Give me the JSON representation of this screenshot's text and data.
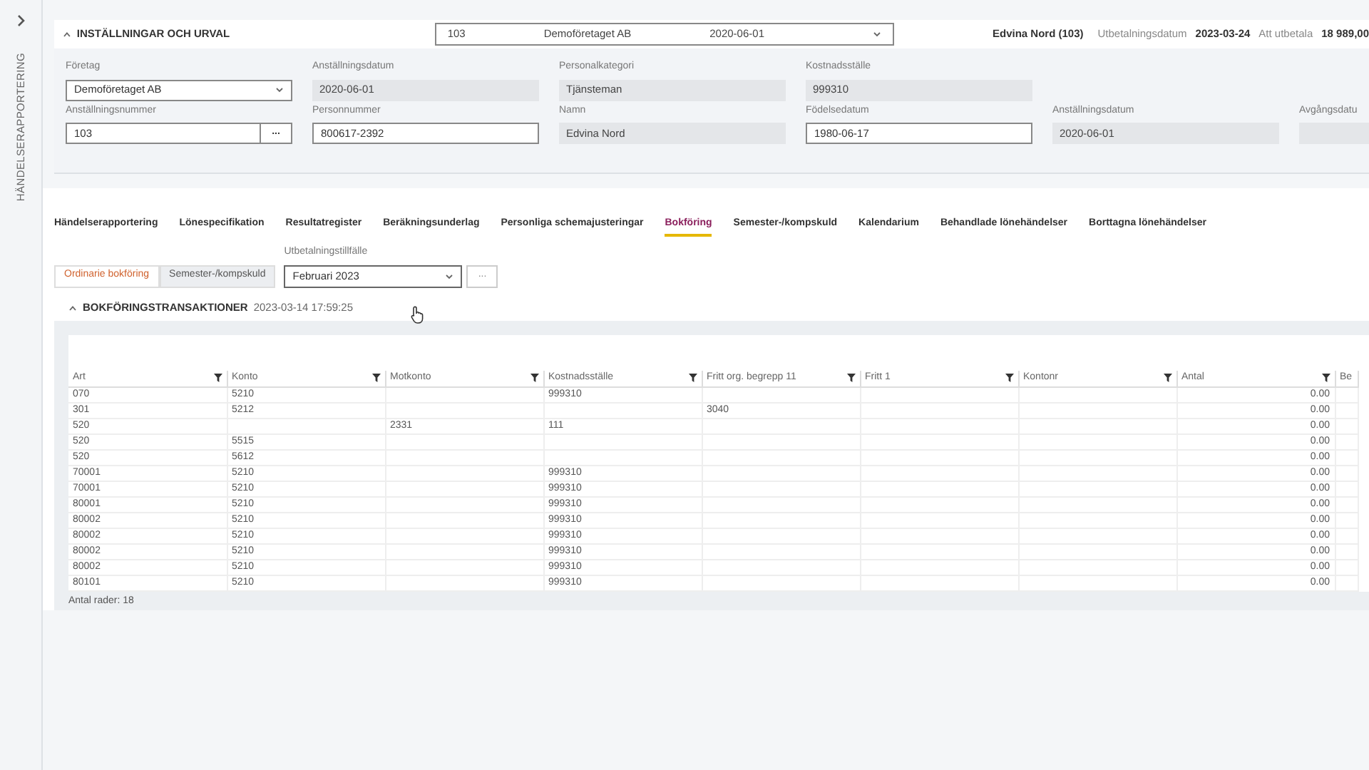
{
  "sidebar": {
    "title": "HÄNDELSERAPPORTERING"
  },
  "header": {
    "title": "INSTÄLLNINGAR OCH URVAL",
    "employee_select": [
      "103",
      "Demoföretaget AB",
      "2020-06-01"
    ],
    "employee": "Edvina Nord (103)",
    "payday_label": "Utbetalningsdatum",
    "payday": "2023-03-24",
    "pay_label": "Att utbetala",
    "pay": "18 989,00"
  },
  "fields": [
    {
      "label": "Företag",
      "value": "Demoföretaget AB",
      "kind": "select"
    },
    {
      "label": "Anställningsdatum",
      "value": "2020-06-01",
      "kind": "readonly"
    },
    {
      "label": "Personalkategori",
      "value": "Tjänsteman",
      "kind": "readonly"
    },
    {
      "label": "Kostnadsställe",
      "value": "999310",
      "kind": "readonly"
    },
    {
      "label": "Anställningsnummer",
      "value": "103",
      "kind": "lookup",
      "button": "..."
    },
    {
      "label": "Personnummer",
      "value": "800617-2392",
      "kind": "input"
    },
    {
      "label": "Namn",
      "value": "Edvina Nord",
      "kind": "readonly"
    },
    {
      "label": "Födelsedatum",
      "value": "1980-06-17",
      "kind": "input"
    },
    {
      "label": "Anställningsdatum",
      "value": "2020-06-01",
      "kind": "readonly"
    },
    {
      "label": "Avgångsdatu",
      "kind": "readonly"
    }
  ],
  "tabs": [
    {
      "label": "Händelserapportering",
      "selected": false
    },
    {
      "label": "Lönespecifikation",
      "selected": false
    },
    {
      "label": "Resultatregister",
      "selected": false
    },
    {
      "label": "Beräkningsunderlag",
      "selected": false
    },
    {
      "label": "Personliga schemajusteringar",
      "selected": false
    },
    {
      "label": "Bokföring",
      "selected": true
    },
    {
      "label": "Semester-/kompskuld",
      "selected": false
    },
    {
      "label": "Kalendarium",
      "selected": false
    },
    {
      "label": "Behandlade lönehändelser",
      "selected": false
    },
    {
      "label": "Borttagna lönehändelser",
      "selected": false
    }
  ],
  "subtabs": [
    {
      "label": "Ordinarie bokföring",
      "selected": true
    },
    {
      "label": "Semester-/kompskuld",
      "selected": false
    }
  ],
  "payout": {
    "label": "Utbetalningstillfälle",
    "value": "Februari 2023",
    "button": "..."
  },
  "section": {
    "title": "BOKFÖRINGSTRANSAKTIONER",
    "timestamp": "2023-03-14 17:59:25"
  },
  "table": {
    "columns": [
      {
        "label": "Art",
        "filter": true,
        "kind": "text"
      },
      {
        "label": "Konto",
        "filter": true,
        "kind": "text"
      },
      {
        "label": "Motkonto",
        "filter": true,
        "kind": "text"
      },
      {
        "label": "Kostnadsställe",
        "filter": true,
        "kind": "text"
      },
      {
        "label": "Fritt org. begrepp 11",
        "filter": true,
        "kind": "text"
      },
      {
        "label": "Fritt 1",
        "filter": true,
        "kind": "text"
      },
      {
        "label": "Kontonr",
        "filter": true,
        "kind": "text"
      },
      {
        "label": "Antal",
        "filter": true,
        "kind": "number"
      },
      {
        "label": "Be",
        "filter": false,
        "kind": "text"
      }
    ],
    "rows": [
      [
        "070",
        "5210",
        null,
        "999310",
        null,
        null,
        null,
        "0.00",
        null
      ],
      [
        "301",
        "5212",
        null,
        null,
        "3040",
        null,
        null,
        "0.00",
        null
      ],
      [
        "520",
        null,
        "2331",
        "111",
        null,
        null,
        null,
        "0.00",
        null
      ],
      [
        "520",
        "5515",
        null,
        null,
        null,
        null,
        null,
        "0.00",
        null
      ],
      [
        "520",
        "5612",
        null,
        null,
        null,
        null,
        null,
        "0.00",
        null
      ],
      [
        "70001",
        "5210",
        null,
        "999310",
        null,
        null,
        null,
        "0.00",
        null
      ],
      [
        "70001",
        "5210",
        null,
        "999310",
        null,
        null,
        null,
        "0.00",
        null
      ],
      [
        "80001",
        "5210",
        null,
        "999310",
        null,
        null,
        null,
        "0.00",
        null
      ],
      [
        "80002",
        "5210",
        null,
        "999310",
        null,
        null,
        null,
        "0.00",
        null
      ],
      [
        "80002",
        "5210",
        null,
        "999310",
        null,
        null,
        null,
        "0.00",
        null
      ],
      [
        "80002",
        "5210",
        null,
        "999310",
        null,
        null,
        null,
        "0.00",
        null
      ],
      [
        "80002",
        "5210",
        null,
        "999310",
        null,
        null,
        null,
        "0.00",
        null
      ],
      [
        "80101",
        "5210",
        null,
        "999310",
        null,
        null,
        null,
        "0.00",
        null
      ]
    ],
    "footer": "Antal rader: 18"
  }
}
